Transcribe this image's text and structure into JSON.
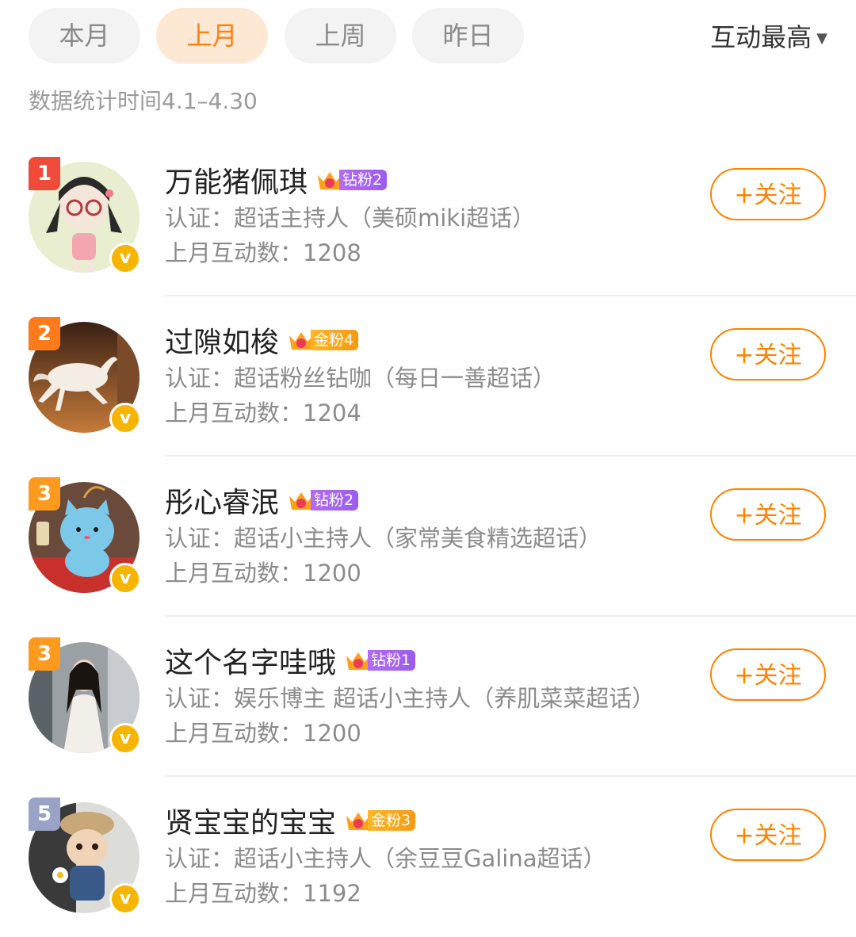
{
  "tabs": [
    {
      "label": "本月",
      "active": false
    },
    {
      "label": "上月",
      "active": true
    },
    {
      "label": "上周",
      "active": false
    },
    {
      "label": "昨日",
      "active": false
    }
  ],
  "sort": {
    "label": "互动最高",
    "icon": "caret-down-icon"
  },
  "stat_time": "数据统计时间4.1–4.30",
  "colors": {
    "accent": "#ff8200",
    "rank1": "#f04a3a",
    "rank2": "#ff7a1a",
    "rank3": "#ff9a1e",
    "rank5": "#9aa3c7",
    "verified": "#f7b500"
  },
  "follow_label": "+关注",
  "users": [
    {
      "rank": "1",
      "name": "万能猪佩琪",
      "fan_badge": "钻粉2",
      "fan_type": "diamond",
      "cert": "认证：超话主持人（美硕miki超话）",
      "count": "上月互动数：1208",
      "avatar": "cartoon-girl-avatar"
    },
    {
      "rank": "2",
      "name": "过隙如梭",
      "fan_badge": "金粉4",
      "fan_type": "gold",
      "cert": "认证：超话粉丝钻咖（每日一善超话）",
      "count": "上月互动数：1204",
      "avatar": "white-horse-avatar"
    },
    {
      "rank": "3",
      "name": "彤心睿泯",
      "fan_badge": "钻粉2",
      "fan_type": "diamond",
      "cert": "认证：超话小主持人（家常美食精选超话）",
      "count": "上月互动数：1200",
      "avatar": "lucky-cat-avatar"
    },
    {
      "rank": "3",
      "name": "这个名字哇哦",
      "fan_badge": "钻粉1",
      "fan_type": "diamond",
      "cert": "认证：娱乐博主 超话小主持人（养肌菜菜超话）",
      "count": "上月互动数：1200",
      "avatar": "woman-photo-avatar"
    },
    {
      "rank": "5",
      "name": "贤宝宝的宝宝",
      "fan_badge": "金粉3",
      "fan_type": "gold",
      "cert": "认证：超话小主持人（余豆豆Galina超话）",
      "count": "上月互动数：1192",
      "avatar": "plush-doll-avatar"
    }
  ]
}
